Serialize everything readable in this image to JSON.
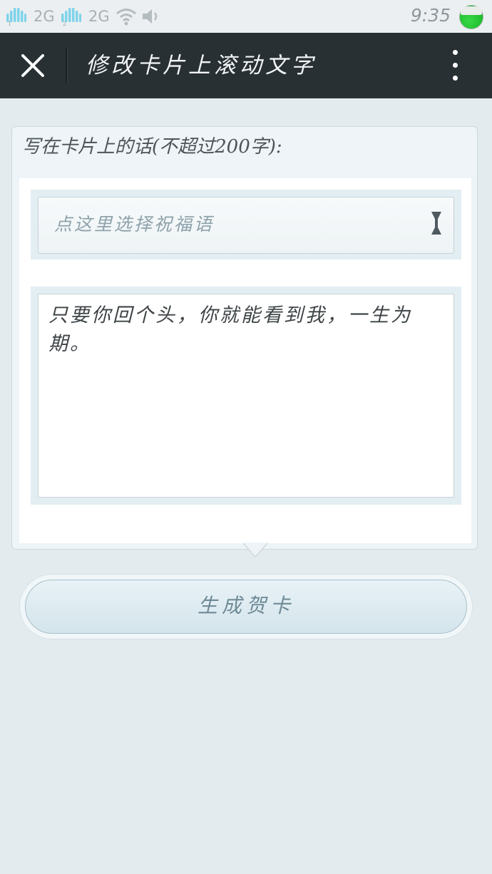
{
  "status_bar": {
    "sim1_network": "2G",
    "sim2_network": "2G",
    "time": "9:35",
    "sim1_icon": "signal-sim1-icon",
    "sim2_icon": "signal-sim2-icon",
    "wifi_icon": "wifi-icon",
    "sound_icon": "speaker-icon",
    "battery_icon": "battery-icon"
  },
  "app_bar": {
    "title": "修改卡片上滚动文字",
    "close_icon": "close-icon",
    "more_icon": "more-vertical-icon"
  },
  "form": {
    "label": "写在卡片上的话(不超过200字):",
    "blessing_select": {
      "placeholder": "点这里选择祝福语"
    },
    "message_text": "只要你回个头，你就能看到我，一生为期。"
  },
  "actions": {
    "generate_label": "生成贺卡"
  },
  "colors": {
    "app_bar_bg": "#283034",
    "page_bg": "#e4ebee",
    "accent_text": "#6f8a96",
    "battery_green": "#1fbf2f"
  }
}
